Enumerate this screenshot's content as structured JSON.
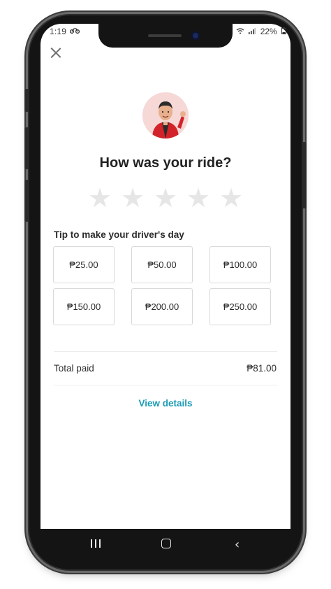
{
  "status_bar": {
    "time": "1:19",
    "battery": "22%"
  },
  "rating": {
    "title": "How was your ride?",
    "stars_total": 5,
    "stars_selected": 0
  },
  "tip": {
    "label": "Tip to make your driver's day",
    "options": [
      "₱25.00",
      "₱50.00",
      "₱100.00",
      "₱150.00",
      "₱200.00",
      "₱250.00"
    ]
  },
  "payment": {
    "total_label": "Total paid",
    "total_value": "₱81.00"
  },
  "links": {
    "view_details": "View details"
  },
  "colors": {
    "accent": "#1a9bb5",
    "star_empty": "#e6e6e6",
    "avatar_bg": "#f6d8d6",
    "jacket_red": "#d2232a"
  },
  "icons": {
    "close": "close-icon",
    "back": "back-icon",
    "home": "home-icon",
    "recents": "recents-icon"
  }
}
